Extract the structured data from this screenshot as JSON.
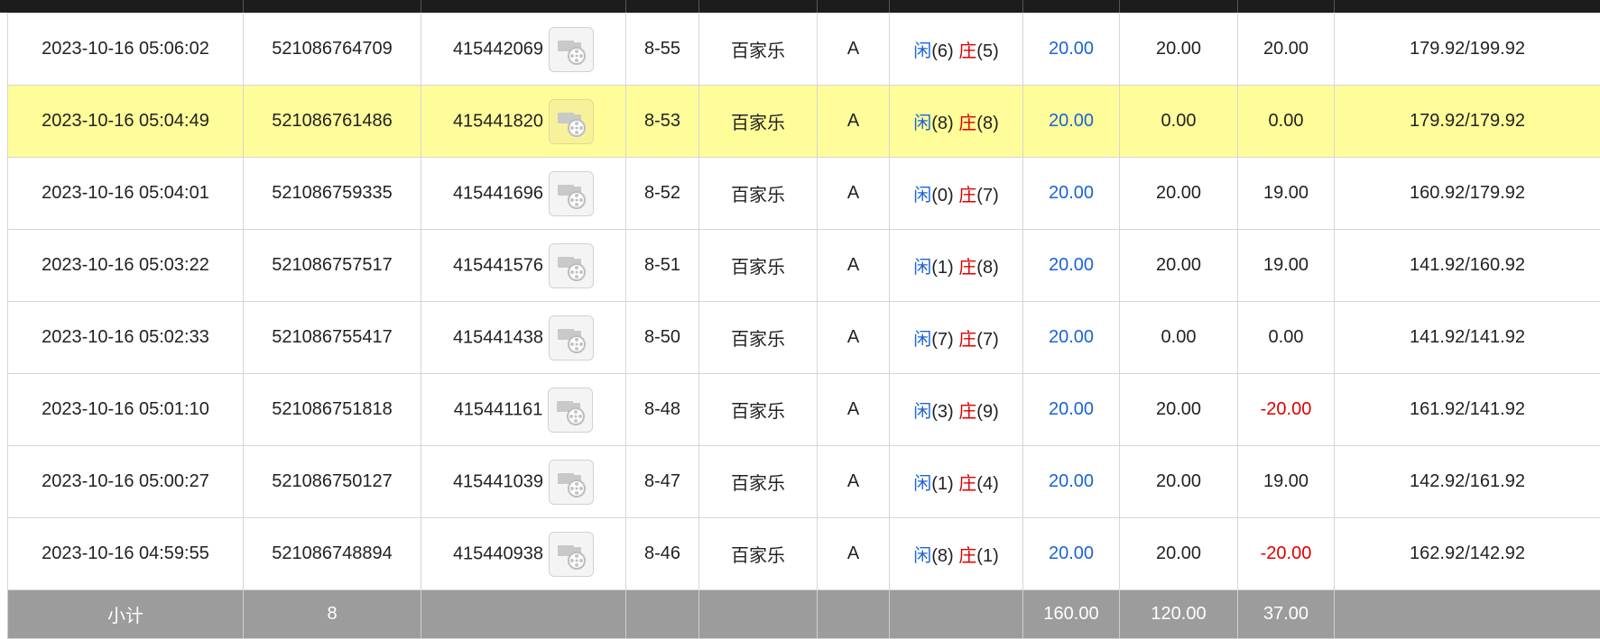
{
  "rows": [
    {
      "time": "2023-10-16 05:06:02",
      "bet_id": "521086764709",
      "game_id": "415442069",
      "table": "8-55",
      "game": "百家乐",
      "type": "A",
      "player_label": "闲",
      "player_score": "(6)",
      "banker_label": "庄",
      "banker_score": "(5)",
      "bet": "20.00",
      "valid": "20.00",
      "winloss": "20.00",
      "balance": "179.92/199.92",
      "highlight": false,
      "negative": false
    },
    {
      "time": "2023-10-16 05:04:49",
      "bet_id": "521086761486",
      "game_id": "415441820",
      "table": "8-53",
      "game": "百家乐",
      "type": "A",
      "player_label": "闲",
      "player_score": "(8)",
      "banker_label": "庄",
      "banker_score": "(8)",
      "bet": "20.00",
      "valid": "0.00",
      "winloss": "0.00",
      "balance": "179.92/179.92",
      "highlight": true,
      "negative": false
    },
    {
      "time": "2023-10-16 05:04:01",
      "bet_id": "521086759335",
      "game_id": "415441696",
      "table": "8-52",
      "game": "百家乐",
      "type": "A",
      "player_label": "闲",
      "player_score": "(0)",
      "banker_label": "庄",
      "banker_score": "(7)",
      "bet": "20.00",
      "valid": "20.00",
      "winloss": "19.00",
      "balance": "160.92/179.92",
      "highlight": false,
      "negative": false
    },
    {
      "time": "2023-10-16 05:03:22",
      "bet_id": "521086757517",
      "game_id": "415441576",
      "table": "8-51",
      "game": "百家乐",
      "type": "A",
      "player_label": "闲",
      "player_score": "(1)",
      "banker_label": "庄",
      "banker_score": "(8)",
      "bet": "20.00",
      "valid": "20.00",
      "winloss": "19.00",
      "balance": "141.92/160.92",
      "highlight": false,
      "negative": false
    },
    {
      "time": "2023-10-16 05:02:33",
      "bet_id": "521086755417",
      "game_id": "415441438",
      "table": "8-50",
      "game": "百家乐",
      "type": "A",
      "player_label": "闲",
      "player_score": "(7)",
      "banker_label": "庄",
      "banker_score": "(7)",
      "bet": "20.00",
      "valid": "0.00",
      "winloss": "0.00",
      "balance": "141.92/141.92",
      "highlight": false,
      "negative": false
    },
    {
      "time": "2023-10-16 05:01:10",
      "bet_id": "521086751818",
      "game_id": "415441161",
      "table": "8-48",
      "game": "百家乐",
      "type": "A",
      "player_label": "闲",
      "player_score": "(3)",
      "banker_label": "庄",
      "banker_score": "(9)",
      "bet": "20.00",
      "valid": "20.00",
      "winloss": "-20.00",
      "balance": "161.92/141.92",
      "highlight": false,
      "negative": true
    },
    {
      "time": "2023-10-16 05:00:27",
      "bet_id": "521086750127",
      "game_id": "415441039",
      "table": "8-47",
      "game": "百家乐",
      "type": "A",
      "player_label": "闲",
      "player_score": "(1)",
      "banker_label": "庄",
      "banker_score": "(4)",
      "bet": "20.00",
      "valid": "20.00",
      "winloss": "19.00",
      "balance": "142.92/161.92",
      "highlight": false,
      "negative": false
    },
    {
      "time": "2023-10-16 04:59:55",
      "bet_id": "521086748894",
      "game_id": "415440938",
      "table": "8-46",
      "game": "百家乐",
      "type": "A",
      "player_label": "闲",
      "player_score": "(8)",
      "banker_label": "庄",
      "banker_score": "(1)",
      "bet": "20.00",
      "valid": "20.00",
      "winloss": "-20.00",
      "balance": "162.92/142.92",
      "highlight": false,
      "negative": true
    }
  ],
  "subtotal": {
    "label": "小计",
    "count": "8",
    "bet": "160.00",
    "valid": "120.00",
    "winloss": "37.00"
  },
  "replay_icon": "video-replay-icon",
  "colors": {
    "player": "#1a63d8",
    "banker": "#e00000",
    "negative": "#e00000",
    "highlight": "#fffd9a",
    "subtotal_bg": "#9c9c9c",
    "header_bg": "#1c1c1c"
  }
}
